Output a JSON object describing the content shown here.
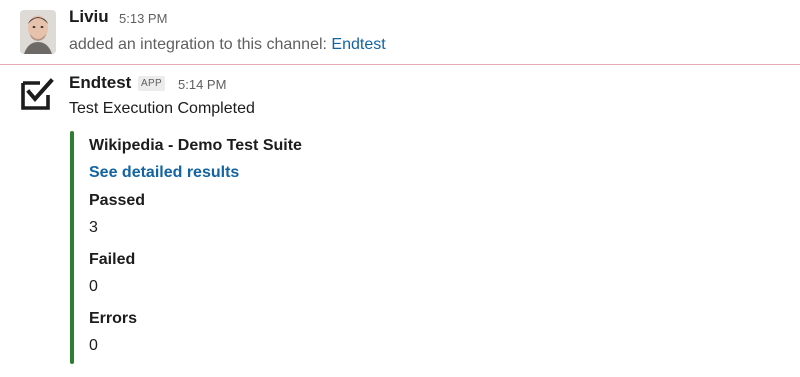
{
  "message1": {
    "author": "Liviu",
    "time": "5:13 PM",
    "text": "added an integration to this channel: ",
    "link": "Endtest"
  },
  "message2": {
    "author": "Endtest",
    "badge": "APP",
    "time": "5:14 PM",
    "text": "Test Execution Completed",
    "attachment": {
      "title": "Wikipedia - Demo Test Suite",
      "link": "See detailed results",
      "accent_color": "#2e7d32",
      "fields": [
        {
          "label": "Passed",
          "value": "3"
        },
        {
          "label": "Failed",
          "value": "0"
        },
        {
          "label": "Errors",
          "value": "0"
        }
      ]
    }
  },
  "colors": {
    "link": "#1264a3",
    "divider": "#e8a9b6",
    "muted_text": "#616061"
  },
  "icons": {
    "app_icon": "checkbox-check-icon",
    "avatar": "user-avatar"
  }
}
